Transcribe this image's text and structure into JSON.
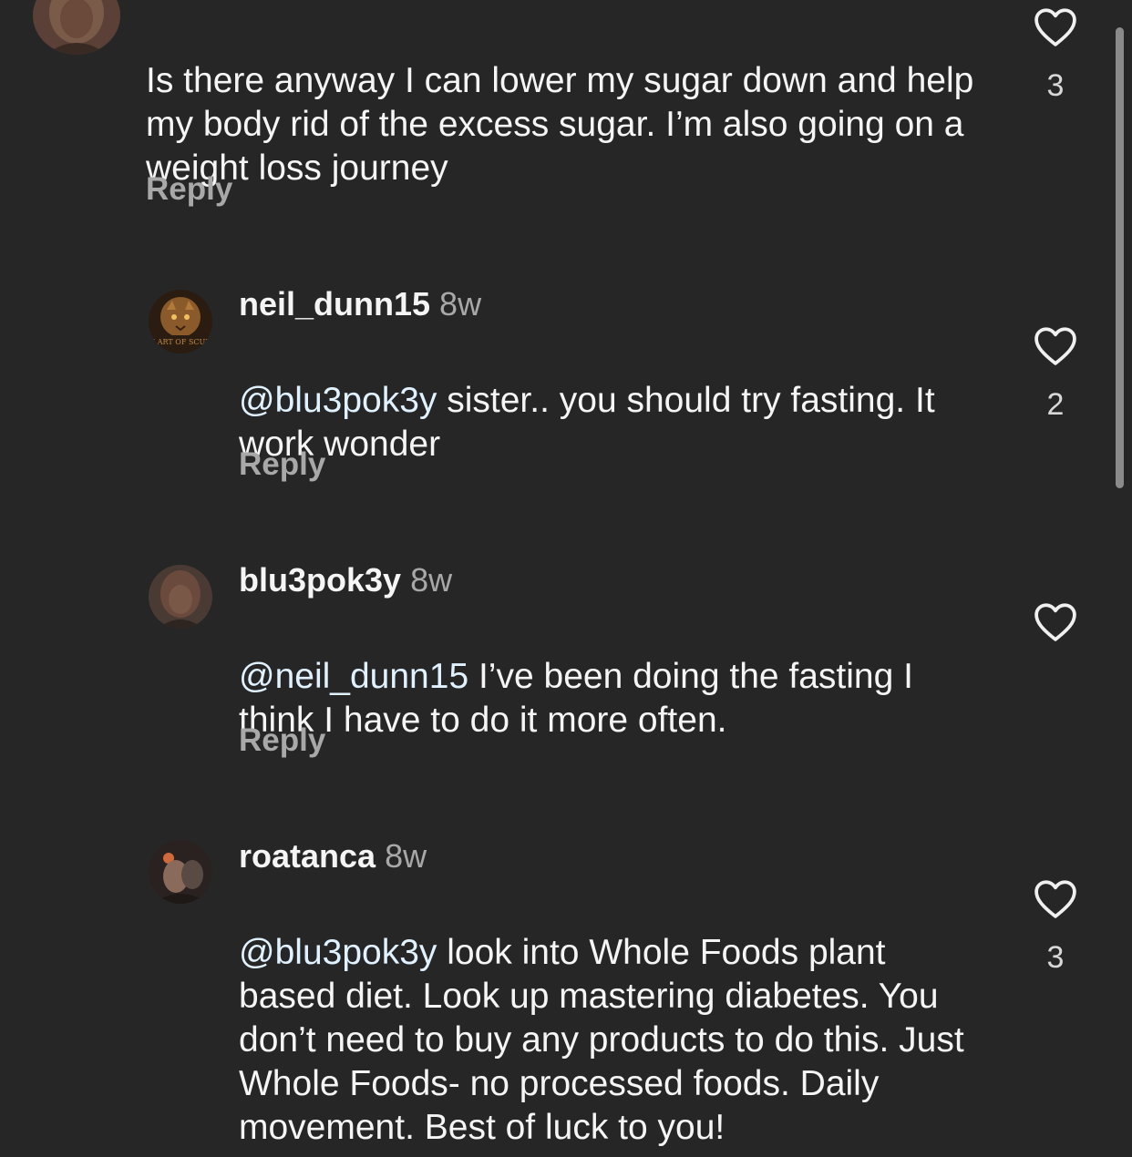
{
  "comments": [
    {
      "username": "",
      "time": "",
      "mention": "",
      "text": "Is there anyway I can lower my sugar down and help my body rid of the excess sugar. I’m also going on a weight loss journey",
      "reply_label": "Reply",
      "likes": "3"
    },
    {
      "username": "neil_dunn15",
      "time": "8w",
      "mention": "@blu3pok3y",
      "text": " sister.. you should try fasting.  It work wonder",
      "reply_label": "Reply",
      "likes": "2"
    },
    {
      "username": "blu3pok3y",
      "time": "8w",
      "mention": "@neil_dunn15",
      "text": " I’ve been doing the fasting I think I have to do it more often.",
      "reply_label": "Reply",
      "likes": ""
    },
    {
      "username": "roatanca",
      "time": "8w",
      "mention": "@blu3pok3y",
      "text": " look into Whole Foods plant based diet. Look up mastering diabetes. You don’t need to buy any products to do this. Just Whole Foods- no processed foods. Daily movement. Best of luck to you!",
      "reply_label": "",
      "likes": "3"
    }
  ],
  "avatar_2_text": "THE ART OF SCULTIS",
  "icons": {
    "like": "heart-outline-icon"
  },
  "colors": {
    "background": "#262626",
    "text": "#f5f5f5",
    "secondary": "#a8a8a8",
    "mention": "#e0f1ff"
  }
}
